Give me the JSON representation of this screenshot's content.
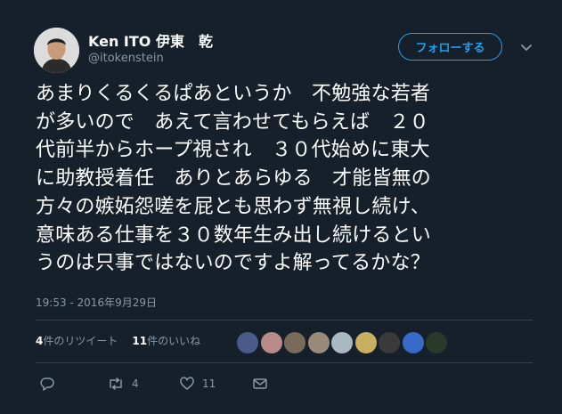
{
  "header": {
    "display_name": "Ken ITO 伊東　乾",
    "handle": "@itokenstein",
    "follow_label": "フォローする"
  },
  "tweet": {
    "lines": [
      "あまりくるくるぱあというか　不勉強な若者",
      "が多いので　あえて言わせてもらえば　２０",
      "代前半からホープ視され　３０代始めに東大",
      "に助教授着任　ありとあらゆる　才能皆無の",
      "方々の嫉妬怨嗟を屁とも思わず無視し続け、",
      "意味ある仕事を３０数年生み出し続けるとい",
      "うのは只事ではないのですよ解ってるかな？"
    ],
    "timestamp": "19:53 - 2016年9月29日"
  },
  "stats": {
    "retweet_count": "4",
    "retweet_label": "件のリツイート",
    "like_count": "11",
    "like_label": "件のいいね"
  },
  "likers": [
    {
      "name": "liker-1",
      "color": "#4a5a8a"
    },
    {
      "name": "liker-2",
      "color": "#b88a8a"
    },
    {
      "name": "liker-3",
      "color": "#7a6a5a"
    },
    {
      "name": "liker-4",
      "color": "#9a8a7a"
    },
    {
      "name": "liker-5",
      "color": "#aab8c2"
    },
    {
      "name": "liker-6",
      "color": "#c8b060"
    },
    {
      "name": "liker-7",
      "color": "#3a3a3a"
    },
    {
      "name": "liker-8",
      "color": "#3a6ac8"
    },
    {
      "name": "liker-9",
      "color": "#2a3a2a"
    }
  ],
  "actions": {
    "reply_icon": "reply-icon",
    "retweet_icon": "retweet-icon",
    "retweet_count": "4",
    "like_icon": "heart-icon",
    "like_count": "11",
    "dm_icon": "envelope-icon"
  },
  "colors": {
    "background": "#15202b",
    "accent": "#1da1f2",
    "muted": "#8899a6",
    "divider": "#38444d"
  }
}
